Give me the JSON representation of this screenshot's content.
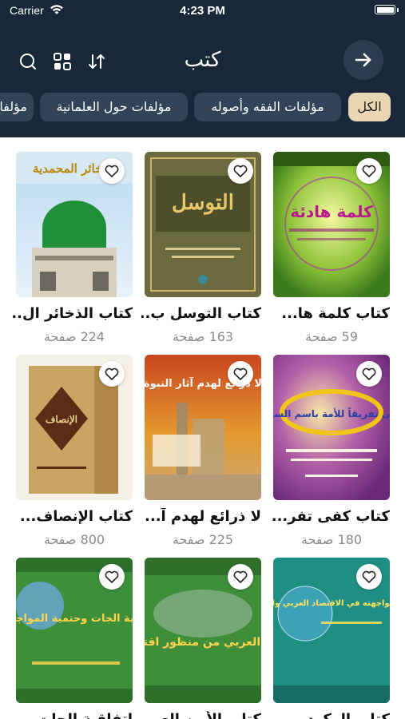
{
  "status_bar": {
    "carrier": "Carrier",
    "time": "4:23 PM"
  },
  "header": {
    "title": "كتب"
  },
  "categories": [
    {
      "label": "الكل",
      "active": true
    },
    {
      "label": "مؤلفات الفقه وأصوله",
      "active": false
    },
    {
      "label": "مؤلفات حول العلمانية",
      "active": false
    },
    {
      "label": "مؤلفا",
      "active": false
    }
  ],
  "books": [
    {
      "title": "كتاب كلمة ها...",
      "pages": "59 صفحة",
      "cover_text": "كلمة هادئة"
    },
    {
      "title": "كتاب التوسل ب...",
      "pages": "163 صفحة",
      "cover_text": "التوسل"
    },
    {
      "title": "كتاب الذخائر ال...",
      "pages": "224 صفحة",
      "cover_text": "الذخائر المحمدية"
    },
    {
      "title": "كتاب كفى تفر...",
      "pages": "180 صفحة",
      "cover_text": "كفى تفريقاً للأمة باسم السلف"
    },
    {
      "title": "لا ذرائع لهدم آ...",
      "pages": "225 صفحة",
      "cover_text": "لا ذرائع لهدم آثار النبوة"
    },
    {
      "title": "كتاب الإنصاف...",
      "pages": "800 صفحة",
      "cover_text": "الإنصاف"
    },
    {
      "title": "كتاب الركود...",
      "pages": "",
      "cover_text": "الركود وسبل مواجهته في الاقتصاد العربي والإسلامي"
    },
    {
      "title": "كتاب الأمن العربي...",
      "pages": "",
      "cover_text": "الأمن العربي من منظور اقتصادي"
    },
    {
      "title": "اتفاقية الجات...",
      "pages": "",
      "cover_text": "اتفاقية الجات وحتمية المواجهة"
    }
  ],
  "colors": {
    "header_bg": "#182838",
    "chip_bg": "#33445a",
    "chip_active_bg": "#e9d7b3"
  },
  "icons": [
    "search-icon",
    "grid-view-icon",
    "sort-icon",
    "arrow-right-icon",
    "heart-icon",
    "wifi-icon",
    "battery-icon"
  ]
}
